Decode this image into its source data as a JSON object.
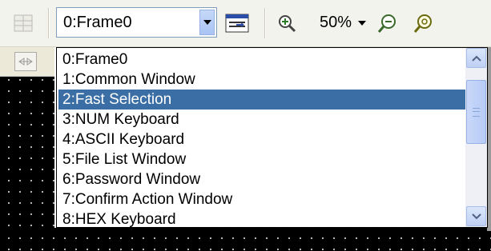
{
  "toolbar": {
    "frame_combo_value": "0:Frame0",
    "zoom_value": "50%"
  },
  "dropdown": {
    "items": [
      "0:Frame0",
      "1:Common Window",
      "2:Fast Selection",
      "3:NUM Keyboard",
      "4:ASCII Keyboard",
      "5:File List Window",
      "6:Password Window",
      "7:Confirm Action Window",
      "8:HEX Keyboard"
    ],
    "selected_index": 2
  },
  "colors": {
    "selection": "#3a6ea5",
    "toolbar_bg": "#f3f3ee"
  }
}
